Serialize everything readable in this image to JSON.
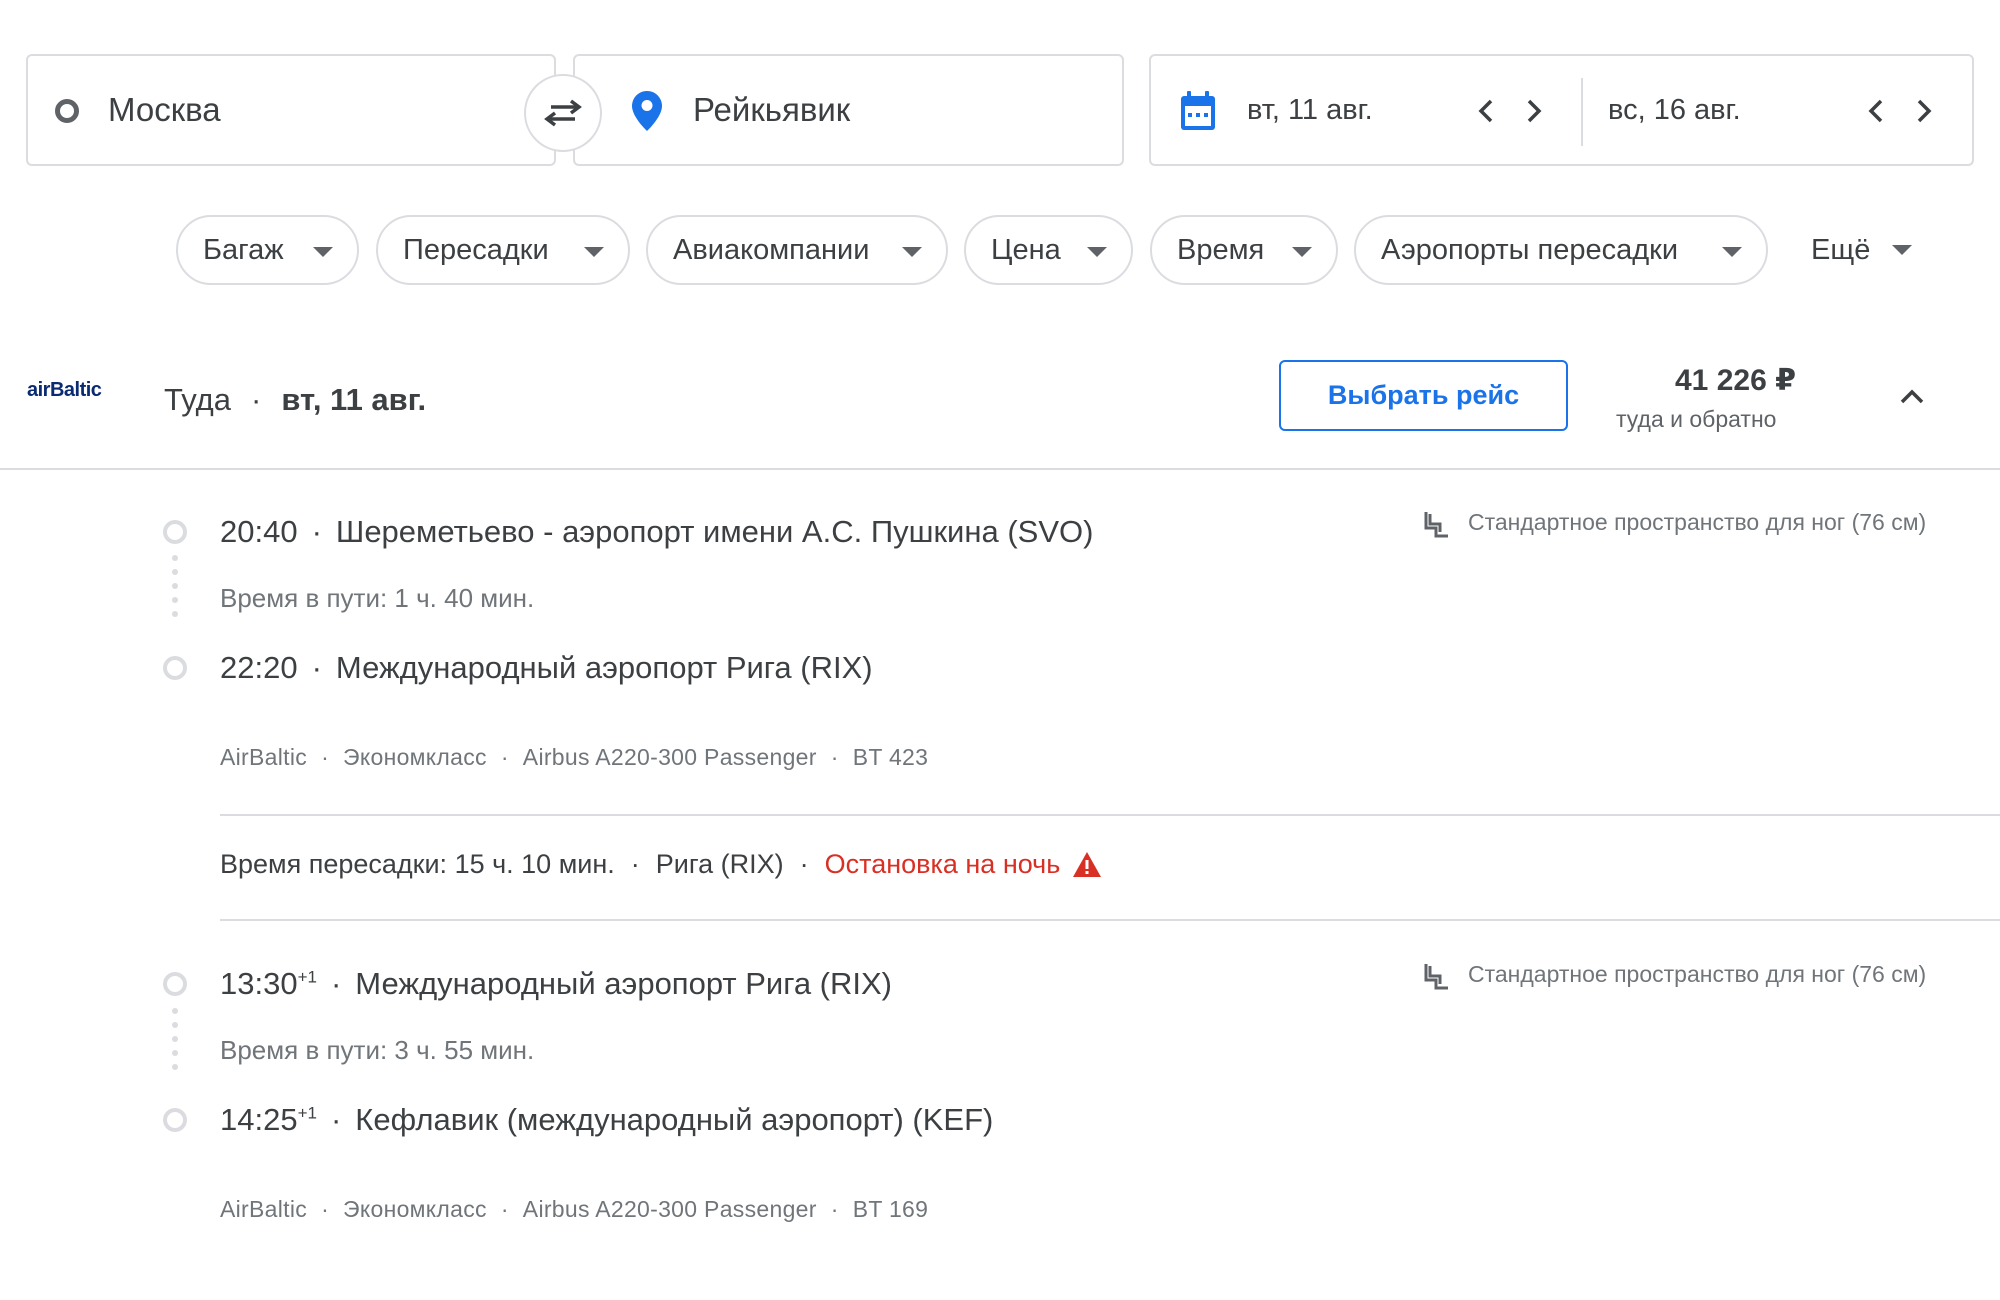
{
  "search": {
    "origin": "Москва",
    "destination": "Рейкьявик",
    "depart_date": "вт, 11 авг.",
    "return_date": "вс, 16 авг."
  },
  "filters": [
    "Багаж",
    "Пересадки",
    "Авиакомпании",
    "Цена",
    "Время",
    "Аэропорты пересадки",
    "Ещё"
  ],
  "flight": {
    "airline_logo_text": "airBaltic",
    "direction": "Туда",
    "date": "вт, 11 авг.",
    "select_label": "Выбрать рейс",
    "price": "41 226 ₽",
    "price_note": "туда и обратно"
  },
  "segments": [
    {
      "dep_time": "20:40",
      "dep_airport": "Шереметьево - аэропорт имени А.С. Пушкина (SVO)",
      "duration": "Время в пути: 1 ч. 40 мин.",
      "arr_time": "22:20",
      "arr_airport": "Международный аэропорт Рига (RIX)",
      "details": [
        "AirBaltic",
        "Экономкласс",
        "Airbus A220-300 Passenger",
        "BT 423"
      ],
      "legroom": "Стандартное пространство для ног (76 см)"
    },
    {
      "dep_time": "13:30",
      "dep_day_offset": "+1",
      "dep_airport": "Международный аэропорт Рига (RIX)",
      "duration": "Время в пути: 3 ч. 55 мин.",
      "arr_time": "14:25",
      "arr_day_offset": "+1",
      "arr_airport": "Кефлавик (международный аэропорт) (KEF)",
      "details": [
        "AirBaltic",
        "Экономкласс",
        "Airbus A220-300 Passenger",
        "BT 169"
      ],
      "legroom": "Стандартное пространство для ног (76 см)"
    }
  ],
  "layover": {
    "duration": "Время пересадки: 15 ч. 10 мин.",
    "city": "Рига (RIX)",
    "warning": "Остановка на ночь"
  },
  "colors": {
    "accent": "#1a73e8",
    "warning": "#d93025",
    "border": "#dadce0",
    "text": "#3c4043",
    "muted": "#70757a"
  }
}
